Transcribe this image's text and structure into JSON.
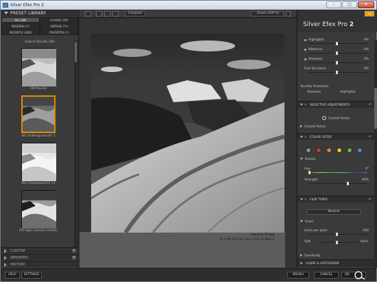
{
  "window": {
    "title": "Silver Efex Pro 2",
    "minimize": "–",
    "maximize": "□",
    "close": "✕"
  },
  "library": {
    "title": "PRESET LIBRARY",
    "tabs": [
      "ALL (38)",
      "CLASSIC (XX)",
      "MODERN (??)",
      "VINTAGE (??)",
      "RECENTLY USED",
      "FAVORITES (?)"
    ],
    "results_label": "Search Results (38)",
    "presets": [
      "000 Neutral",
      "001 Underexposed EV -1",
      "002 Overexposed EV +1",
      "003 High Contrast (smooth)"
    ]
  },
  "sections": [
    {
      "label": "CUSTOM",
      "plus": "+"
    },
    {
      "label": "IMPORTED",
      "plus": "+"
    },
    {
      "label": "HISTORY"
    }
  ],
  "toolbar": {
    "compare_label": "Compare",
    "zoom_label": "Zoom (100 %)"
  },
  "photo": {
    "filename": "colorado_03.jpg",
    "meta": "37 k MP, ISO 100  Canon EOS 5D Mark II"
  },
  "right": {
    "brand": "Silver Efex Pro",
    "brand_num": "2",
    "logo": "Nik",
    "sliders_top": [
      {
        "label": "Highlights",
        "value": "0%"
      },
      {
        "label": "Midtones",
        "value": "0%"
      },
      {
        "label": "Shadows",
        "value": "0%"
      },
      {
        "label": "Fine Structure",
        "value": "0%"
      }
    ],
    "tonality_label": "Tonality Protection",
    "shadows_label": "Shadows",
    "highlights_label": "Highlights",
    "selective_label": "SELECTIVE ADJUSTMENTS",
    "control_points_btn": "Control Points",
    "control_points_label": "Control Points",
    "color_filter_label": "COLOR FILTER",
    "color_dots": [
      "#8d8d8d",
      "#c83b35",
      "#d8872b",
      "#d9c530",
      "#66b34a",
      "#5a86c9"
    ],
    "details_label": "Details",
    "hue_label": "Hue",
    "hue_value": "0°",
    "strength_label": "Strength",
    "strength_value": "66%",
    "film_types_label": "FILM TYPES",
    "film_select": "Neutral",
    "grain_label": "Grain",
    "grain_per_pixel": "Grain per pixel",
    "grain_value": "500",
    "soft_label": "Soft",
    "hard_label": "Hard",
    "sensitivity_label": "Sensitivity",
    "loupe_label": "LOUPE & HISTOGRAM"
  },
  "bottom": {
    "help": "HELP",
    "settings": "SETTINGS",
    "brush": "BRUSH",
    "cancel": "CANCEL",
    "ok": "OK"
  }
}
